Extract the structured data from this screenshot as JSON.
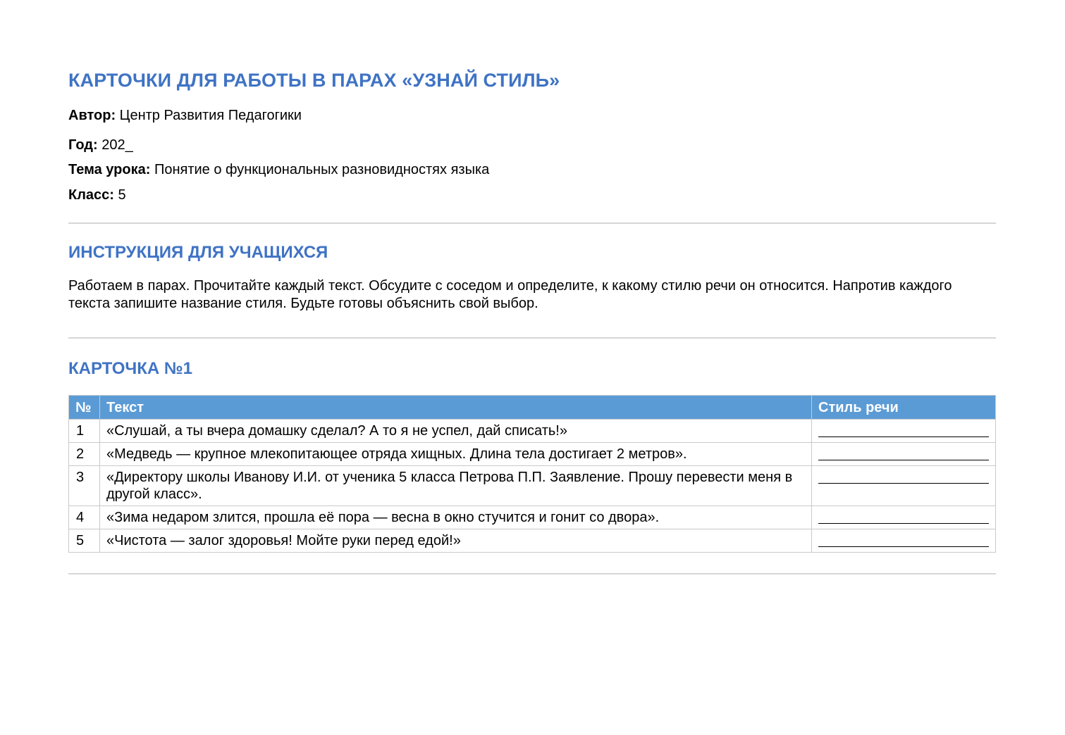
{
  "document": {
    "title": "КАРТОЧКИ ДЛЯ РАБОТЫ В ПАРАХ «УЗНАЙ СТИЛЬ»",
    "title_color": "#3f73c4",
    "meta": {
      "author_label": "Автор:",
      "author_value": "Центр Развития Педагогики",
      "year_label": "Год:",
      "year_value": "202_",
      "topic_label": "Тема урока:",
      "topic_value": "Понятие о функциональных разновидностях языка",
      "class_label": "Класс:",
      "class_value": "5"
    }
  },
  "instructions": {
    "title": "ИНСТРУКЦИЯ ДЛЯ УЧАЩИХСЯ",
    "text": "Работаем в парах. Прочитайте каждый текст. Обсудите с соседом и определите, к какому стилю речи он относится. Напротив каждого текста запишите название стиля. Будьте готовы объяснить свой выбор."
  },
  "card": {
    "title": "КАРТОЧКА №1",
    "header_color": "#5b9bd5",
    "columns": {
      "num": "№",
      "text": "Текст",
      "style": "Стиль речи"
    },
    "rows": [
      {
        "num": "1",
        "text": "«Слушай, а ты вчера домашку сделал? А то я не успел, дай списать!»"
      },
      {
        "num": "2",
        "text": "«Медведь — крупное млекопитающее отряда хищных. Длина тела достигает 2 метров»."
      },
      {
        "num": "3",
        "text": "«Директору школы Иванову И.И. от ученика 5 класса Петрова П.П. Заявление. Прошу перевести меня в другой класс»."
      },
      {
        "num": "4",
        "text": "«Зима недаром злится, прошла её пора — весна в окно стучится и гонит со двора»."
      },
      {
        "num": "5",
        "text": "«Чистота — залог здоровья! Мойте руки перед едой!»"
      }
    ]
  }
}
